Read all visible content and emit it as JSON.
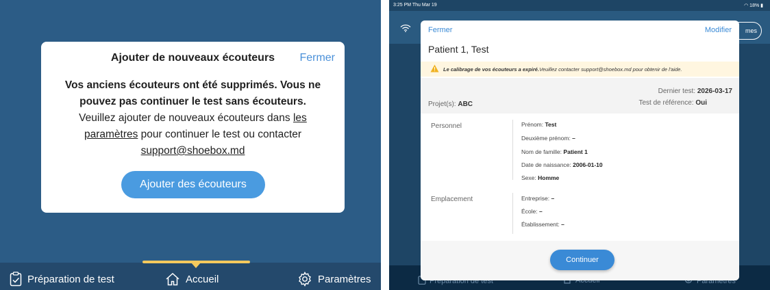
{
  "left": {
    "modal": {
      "title": "Ajouter de nouveaux écouteurs",
      "close_label": "Fermer",
      "message_bold_1": "Vos anciens écouteurs ont été supprimés. Vous ne",
      "message_bold_2": "pouvez pas continuer le test sans écouteurs.",
      "message_line_3_prefix": "Veuillez ajouter de nouveaux écouteurs dans ",
      "message_link_1a": "les",
      "message_link_1b": "paramètres",
      "message_line_4_suffix": " pour continuer le test ou contacter",
      "message_link_2": "support@shoebox.md",
      "button_label": "Ajouter des écouteurs"
    },
    "nav": {
      "item_1": "Préparation de test",
      "item_2": "Accueil",
      "item_3": "Paramètres"
    }
  },
  "right": {
    "status": {
      "time": "3:25 PM  Thu Mar 19",
      "battery": "18%"
    },
    "header_pill_text": "mes",
    "card": {
      "close_label": "Fermer",
      "edit_label": "Modifier",
      "patient_name": "Patient 1, Test",
      "warning_bold": "Le calibrage de vos écouteurs a expiré.",
      "warning_text": " Veuillez contacter support@shoebox.md pour obtenir de l'aide.",
      "last_test_label": "Dernier test: ",
      "last_test_value": "2026-03-17",
      "project_label": "Projet(s): ",
      "project_value": "ABC",
      "reference_label": "Test de référence: ",
      "reference_value": "Oui",
      "sections": {
        "personnel": {
          "label": "Personnel",
          "fields": [
            {
              "label": "Prénom: ",
              "value": "Test"
            },
            {
              "label": "Deuxième prénom: ",
              "value": "–"
            },
            {
              "label": "Nom de famille: ",
              "value": "Patient 1"
            },
            {
              "label": "Date de naissance: ",
              "value": "2006-01-10"
            },
            {
              "label": "Sexe: ",
              "value": "Homme"
            }
          ]
        },
        "emplacement": {
          "label": "Emplacement",
          "fields": [
            {
              "label": "Entreprise: ",
              "value": "–"
            },
            {
              "label": "École: ",
              "value": "–"
            },
            {
              "label": "Établissement: ",
              "value": "–"
            }
          ]
        }
      },
      "continue_label": "Continuer"
    },
    "nav": {
      "item_1": "Préparation de test",
      "item_2": "Accueil",
      "item_3": "Paramètres"
    }
  },
  "colors": {
    "left_background": "#2c5c86",
    "accent_blue": "#4a9be0",
    "indicator_yellow": "#f4c95d",
    "right_background": "#1e4565",
    "warning_background": "#fff6e0"
  }
}
